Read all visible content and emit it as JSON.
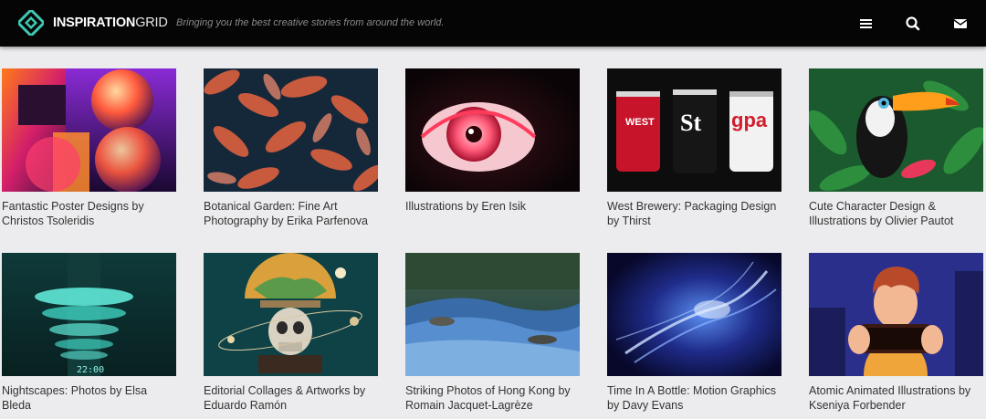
{
  "header": {
    "brand_bold": "INSPIRATION",
    "brand_light": "GRID",
    "tagline": "Bringing you the best creative stories from around the world.",
    "icons": [
      "menu-icon",
      "search-icon",
      "mail-icon"
    ]
  },
  "colors": {
    "header_bg": "#050505",
    "page_bg": "#ececee",
    "logo_accent": "#3fc7b3",
    "caption_text": "#333333"
  },
  "articles": [
    {
      "title": "Fantastic Poster Designs by Christos Tsoleridis"
    },
    {
      "title": "Botanical Garden: Fine Art Photography by Erika Parfenova"
    },
    {
      "title": "Illustrations by Eren Isik"
    },
    {
      "title": "West Brewery: Packaging Design by Thirst"
    },
    {
      "title": "Cute Character Design & Illustrations by Olivier Pautot"
    },
    {
      "title": "Nightscapes: Photos by Elsa Bleda"
    },
    {
      "title": "Editorial Collages & Artworks by Eduardo Ramón"
    },
    {
      "title": "Striking Photos of Hong Kong by Romain Jacquet-Lagrèze"
    },
    {
      "title": "Time In A Bottle: Motion Graphics by Davy Evans"
    },
    {
      "title": "Atomic Animated Illustrations by Kseniya Forbender"
    }
  ],
  "thumb_text": {
    "can1": "WEST",
    "can2": "St",
    "can3": "gpa",
    "clock": "22:00"
  }
}
